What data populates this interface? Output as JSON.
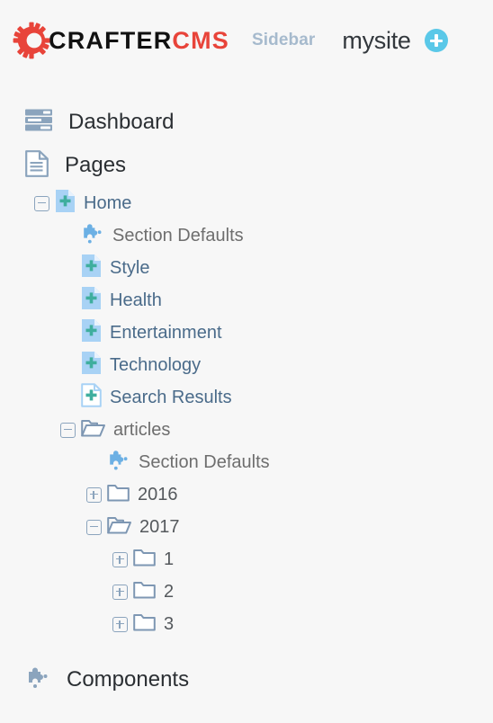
{
  "header": {
    "logo": {
      "icon": "crafter-gear-icon",
      "wordmark_dark": "CRAFTER",
      "wordmark_red": "CMS",
      "gear_color": "#e8443a",
      "dark_color": "#111111",
      "red_color": "#e8443a"
    },
    "sidebar_label": "Sidebar",
    "site_name": "mysite",
    "add_button": {
      "icon": "plus-circle-icon",
      "color": "#5ac8e8"
    }
  },
  "tree": {
    "dashboard": {
      "label": "Dashboard",
      "icon": "dashboard-bars-icon"
    },
    "pages": {
      "label": "Pages",
      "icon": "page-lines-icon"
    },
    "items": [
      {
        "label": "Home",
        "icon": "page-plus-filled-icon",
        "toggle": "minus",
        "indent": 0,
        "style": "page"
      },
      {
        "label": "Section Defaults",
        "icon": "puzzle-icon",
        "toggle": "none",
        "indent": 1,
        "style": "muted"
      },
      {
        "label": "Style",
        "icon": "page-plus-filled-icon",
        "toggle": "none",
        "indent": 1,
        "style": "page"
      },
      {
        "label": "Health",
        "icon": "page-plus-filled-icon",
        "toggle": "none",
        "indent": 1,
        "style": "page"
      },
      {
        "label": "Entertainment",
        "icon": "page-plus-filled-icon",
        "toggle": "none",
        "indent": 1,
        "style": "page"
      },
      {
        "label": "Technology",
        "icon": "page-plus-filled-icon",
        "toggle": "none",
        "indent": 1,
        "style": "page"
      },
      {
        "label": "Search Results",
        "icon": "page-plus-outline-icon",
        "toggle": "none",
        "indent": 1,
        "style": "page"
      },
      {
        "label": "articles",
        "icon": "folder-open-icon",
        "toggle": "minus",
        "indent": 1,
        "style": "folder"
      },
      {
        "label": "Section Defaults",
        "icon": "puzzle-icon",
        "toggle": "none",
        "indent": 2,
        "style": "muted"
      },
      {
        "label": "2016",
        "icon": "folder-closed-icon",
        "toggle": "plus",
        "indent": 2,
        "style": "foldernum"
      },
      {
        "label": "2017",
        "icon": "folder-open-icon",
        "toggle": "minus",
        "indent": 2,
        "style": "foldernum"
      },
      {
        "label": "1",
        "icon": "folder-closed-icon",
        "toggle": "plus",
        "indent": 3,
        "style": "foldernum"
      },
      {
        "label": "2",
        "icon": "folder-closed-icon",
        "toggle": "plus",
        "indent": 3,
        "style": "foldernum"
      },
      {
        "label": "3",
        "icon": "folder-closed-icon",
        "toggle": "plus",
        "indent": 3,
        "style": "foldernum"
      }
    ],
    "components": {
      "label": "Components",
      "icon": "puzzle-slate-icon"
    }
  },
  "colors": {
    "background": "#f7f7f7",
    "page_icon_fill": "#a8d2f5",
    "page_icon_plus": "#3fae9e",
    "folder_outline": "#7e97b3",
    "slate": "#8ba4bd",
    "page_text": "#4a6b8a",
    "muted_text": "#6e6e6e"
  }
}
